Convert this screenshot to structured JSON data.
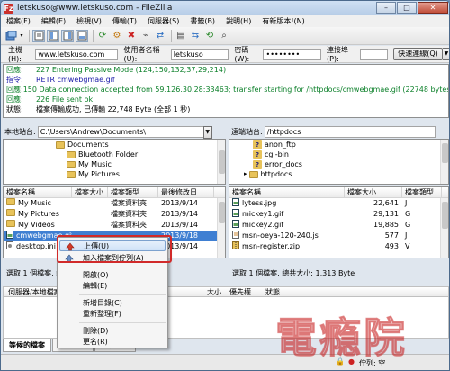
{
  "window": {
    "title": "letskuso@www.letskuso.com - FileZilla",
    "app_icon": "Fz",
    "controls": [
      "–",
      "□",
      "✕"
    ]
  },
  "menu": [
    "檔案(F)",
    "編輯(E)",
    "檢視(V)",
    "傳輸(T)",
    "伺服器(S)",
    "書籤(B)",
    "說明(H)",
    "有新版本!(N)"
  ],
  "toolbar": {
    "icons": [
      "site-manager-icon",
      "toggle-log-icon",
      "toggle-local-tree-icon",
      "toggle-remote-tree-icon",
      "toggle-queue-icon",
      "refresh-icon",
      "process-queue-icon",
      "cancel-icon",
      "disconnect-icon",
      "reconnect-icon",
      "filter-icon",
      "compare-icon",
      "sync-browse-icon",
      "search-icon"
    ]
  },
  "quickconnect": {
    "host_label": "主機(H):",
    "host_value": "www.letskuso.com",
    "user_label": "使用者名稱(U):",
    "user_value": "letskuso",
    "pass_label": "密碼(W):",
    "pass_value": "••••••••",
    "port_label": "連接埠(P):",
    "port_value": "",
    "button_label": "快速連線(Q)",
    "dropdown": "▼"
  },
  "log": [
    {
      "type": "resp",
      "key": "回應:",
      "text": "227 Entering Passive Mode (124,150,132,37,29,214)"
    },
    {
      "type": "cmd",
      "key": "指令:",
      "text": "RETR cmwebgmae.gif"
    },
    {
      "type": "resp",
      "key": "回應:",
      "text": "150 Data connection accepted from 59.126.30.28:33463; transfer starting for /httpdocs/cmwebgmae.gif (22748 bytes)"
    },
    {
      "type": "resp",
      "key": "回應:",
      "text": "226 File sent ok."
    },
    {
      "type": "stat",
      "key": "狀態:",
      "text": "檔案傳輸成功, 已傳輸 22,748 Byte (全部 1 秒)"
    }
  ],
  "local": {
    "site_label": "本地站台:",
    "site_path": "C:\\Users\\Andrew\\Documents\\",
    "tree": [
      {
        "name": "Documents",
        "level": 0
      },
      {
        "name": "Bluetooth Folder",
        "level": 1
      },
      {
        "name": "My Music",
        "level": 1
      },
      {
        "name": "My Pictures",
        "level": 1
      }
    ],
    "columns": [
      "檔案名稱",
      "檔案大小",
      "檔案類型",
      "最後修改日"
    ],
    "files": [
      {
        "name": "My Music",
        "size": "",
        "type": "檔案資料夾",
        "date": "2013/9/14",
        "icon": "folder"
      },
      {
        "name": "My Pictures",
        "size": "",
        "type": "檔案資料夾",
        "date": "2013/9/14",
        "icon": "folder"
      },
      {
        "name": "My Videos",
        "size": "",
        "type": "檔案資料夾",
        "date": "2013/9/14",
        "icon": "folder"
      },
      {
        "name": "cmwebgmae.gif",
        "size": "",
        "type": "",
        "date": "2013/9/18",
        "icon": "image",
        "selected": true
      },
      {
        "name": "desktop.ini",
        "size": "",
        "type": "",
        "date": "2013/9/14",
        "icon": "file"
      }
    ],
    "status": "選取 1 個檔案. 總共大小..."
  },
  "remote": {
    "site_label": "遠端站台:",
    "site_path": "/httpdocs",
    "tree": [
      {
        "name": "anon_ftp",
        "icon": "unknown"
      },
      {
        "name": "cgi-bin",
        "icon": "unknown"
      },
      {
        "name": "error_docs",
        "icon": "unknown"
      },
      {
        "name": "httpdocs",
        "icon": "folder"
      }
    ],
    "columns": [
      "檔案名稱",
      "檔案大小",
      "檔案類型"
    ],
    "files": [
      {
        "name": "lytess.jpg",
        "size": "22,641",
        "type": "J",
        "icon": "image"
      },
      {
        "name": "mickey1.gif",
        "size": "29,131",
        "type": "G",
        "icon": "image"
      },
      {
        "name": "mickey2.gif",
        "size": "19,885",
        "type": "G",
        "icon": "image"
      },
      {
        "name": "msn-oeya-120-240.js",
        "size": "577",
        "type": "J",
        "icon": "script"
      },
      {
        "name": "msn-register.zip",
        "size": "493",
        "type": "V",
        "icon": "zip"
      }
    ],
    "status": "選取 1 個檔案. 總共大小: 1,313 Byte"
  },
  "context_menu": {
    "items": [
      {
        "label": "上傳(U)",
        "icon": "upload-icon",
        "highlight": true
      },
      {
        "label": "加入檔案到佇列(A)",
        "icon": "add-to-queue-icon"
      },
      {
        "sep": true
      },
      {
        "label": "開啟(O)"
      },
      {
        "label": "編輯(E)"
      },
      {
        "sep": true
      },
      {
        "label": "新增目錄(C)"
      },
      {
        "label": "重新整理(F)"
      },
      {
        "sep": true
      },
      {
        "label": "刪除(D)"
      },
      {
        "label": "更名(R)"
      }
    ]
  },
  "queue": {
    "columns": [
      "伺服器/本地檔案",
      "大小",
      "優先權",
      "狀態"
    ],
    "tabs": [
      "等候的檔案",
      "傳輸失敗",
      "成功傳輸"
    ]
  },
  "statusbar": {
    "queue_text": "佇列: 空"
  },
  "watermark": "電瘾院"
}
